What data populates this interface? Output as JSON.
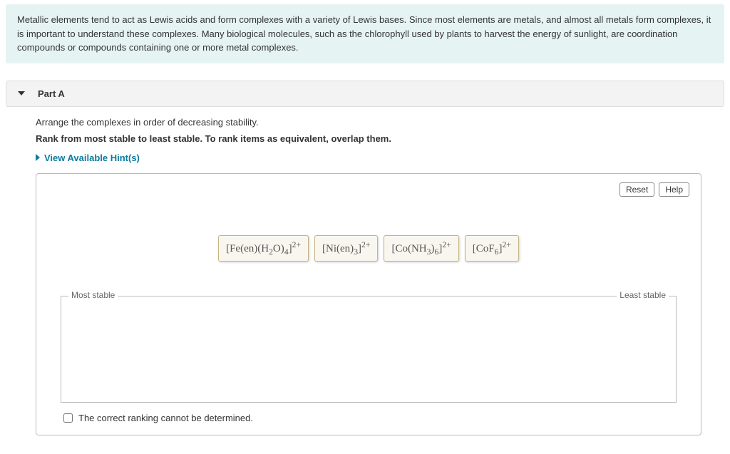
{
  "intro": "Metallic elements tend to act as Lewis acids and form complexes with a variety of Lewis bases. Since most elements are metals, and almost all metals form complexes, it is important to understand these complexes. Many biological molecules, such as the chlorophyll used by plants to harvest the energy of sunlight, are coordination compounds or compounds containing one or more metal complexes.",
  "part": {
    "label": "Part A",
    "question": "Arrange the complexes in order of decreasing stability.",
    "instruction": "Rank from most stable to least stable. To rank items as equivalent, overlap them.",
    "hints_label": "View Available Hint(s)"
  },
  "buttons": {
    "reset": "Reset",
    "help": "Help"
  },
  "items": [
    {
      "html": "[Fe(en)(H<sub>2</sub>O)<sub>4</sub>]<sup>2+</sup>"
    },
    {
      "html": "[Ni(en)<sub>3</sub>]<sup>2+</sup>"
    },
    {
      "html": "[Co(NH<sub>3</sub>)<sub>6</sub>]<sup>2+</sup>"
    },
    {
      "html": "[CoF<sub>6</sub>]<sup>2+</sup>"
    }
  ],
  "zone": {
    "left_label": "Most stable",
    "right_label": "Least stable"
  },
  "cannot_determine": "The correct ranking cannot be determined."
}
